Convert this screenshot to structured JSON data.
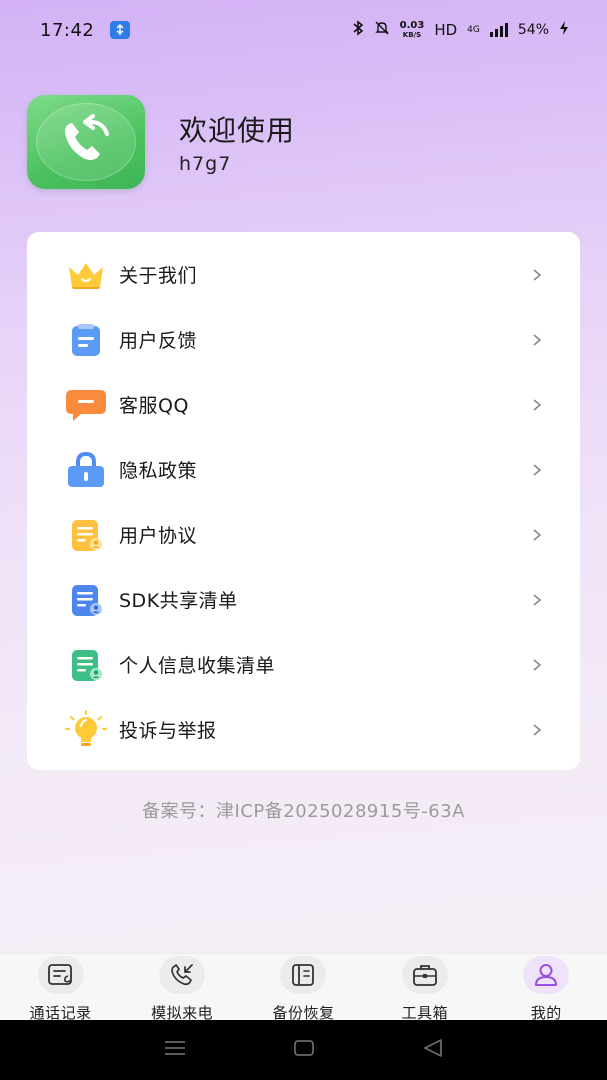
{
  "status_bar": {
    "time": "17:42",
    "net_speed_value": "0.03",
    "net_speed_unit": "KB/S",
    "hd": "HD",
    "network": "4G",
    "battery": "54%"
  },
  "header": {
    "welcome": "欢迎使用",
    "user_name": "h7g7"
  },
  "menu": {
    "items": [
      {
        "label": "关于我们",
        "icon": "crown-icon"
      },
      {
        "label": "用户反馈",
        "icon": "feedback-note-icon"
      },
      {
        "label": "客服QQ",
        "icon": "chat-bubble-icon"
      },
      {
        "label": "隐私政策",
        "icon": "lock-icon"
      },
      {
        "label": "用户协议",
        "icon": "agreement-doc-icon"
      },
      {
        "label": "SDK共享清单",
        "icon": "sdk-list-icon"
      },
      {
        "label": "个人信息收集清单",
        "icon": "personal-info-list-icon"
      },
      {
        "label": "投诉与举报",
        "icon": "lightbulb-icon"
      }
    ]
  },
  "footer": {
    "icp": "备案号：津ICP备2025028915号-63A"
  },
  "tabs": [
    {
      "label": "通话记录",
      "icon": "call-log-icon"
    },
    {
      "label": "模拟来电",
      "icon": "incoming-call-icon"
    },
    {
      "label": "备份恢复",
      "icon": "backup-icon"
    },
    {
      "label": "工具箱",
      "icon": "toolbox-icon"
    },
    {
      "label": "我的",
      "icon": "profile-icon",
      "active": true
    }
  ],
  "colors": {
    "accent": "#9b4fe0",
    "app_icon_green": "#4cc25f",
    "icp_text": "#9b9b9b"
  }
}
